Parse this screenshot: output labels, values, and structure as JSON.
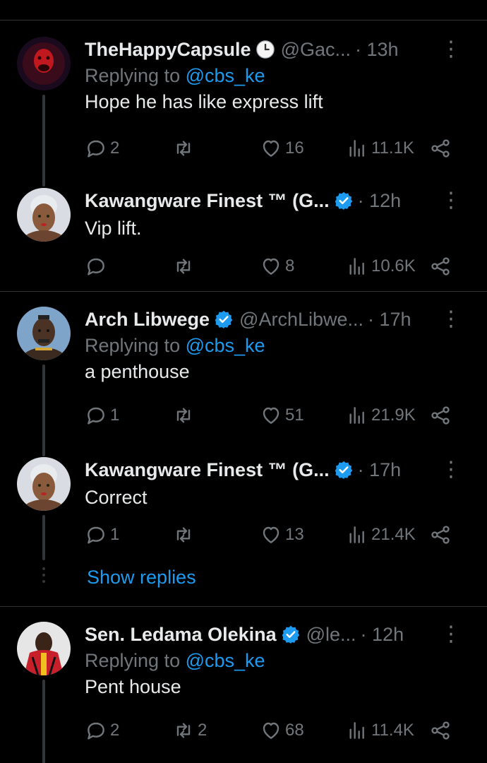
{
  "colors": {
    "background": "#000000",
    "text": "#e7e9ea",
    "muted": "#71767b",
    "link": "#1d9bf0",
    "divider": "#2f3336",
    "verified": "#1d9bf0"
  },
  "tweets": [
    {
      "name": "TheHappyCapsule",
      "badge": "clock-icon",
      "handle": "@Gac...",
      "time": "· 13h",
      "replying_label": "Replying to",
      "replying_to": "@cbs_ke",
      "text": "Hope he has like express lift",
      "replies": "2",
      "retweets": "",
      "likes": "16",
      "views": "11.1K"
    },
    {
      "name": "Kawangware Finest ™ (G...",
      "badge": "verified-icon",
      "handle": "",
      "time": "· 12h",
      "text": "Vip lift.",
      "replies": "",
      "retweets": "",
      "likes": "8",
      "views": "10.6K"
    },
    {
      "name": "Arch Libwege",
      "badge": "verified-icon",
      "handle": "@ArchLibwe...",
      "time": "· 17h",
      "replying_label": "Replying to",
      "replying_to": "@cbs_ke",
      "text": "a penthouse",
      "replies": "1",
      "retweets": "",
      "likes": "51",
      "views": "21.9K"
    },
    {
      "name": "Kawangware Finest ™ (G...",
      "badge": "verified-icon",
      "handle": "",
      "time": "· 17h",
      "text": "Correct",
      "replies": "1",
      "retweets": "",
      "likes": "13",
      "views": "21.4K"
    },
    {
      "name": "Sen. Ledama Olekina",
      "badge": "verified-icon",
      "handle": "@le...",
      "time": "· 12h",
      "replying_label": "Replying to",
      "replying_to": "@cbs_ke",
      "text": "Pent house",
      "replies": "2",
      "retweets": "2",
      "likes": "68",
      "views": "11.4K"
    }
  ],
  "show_replies": "Show replies"
}
